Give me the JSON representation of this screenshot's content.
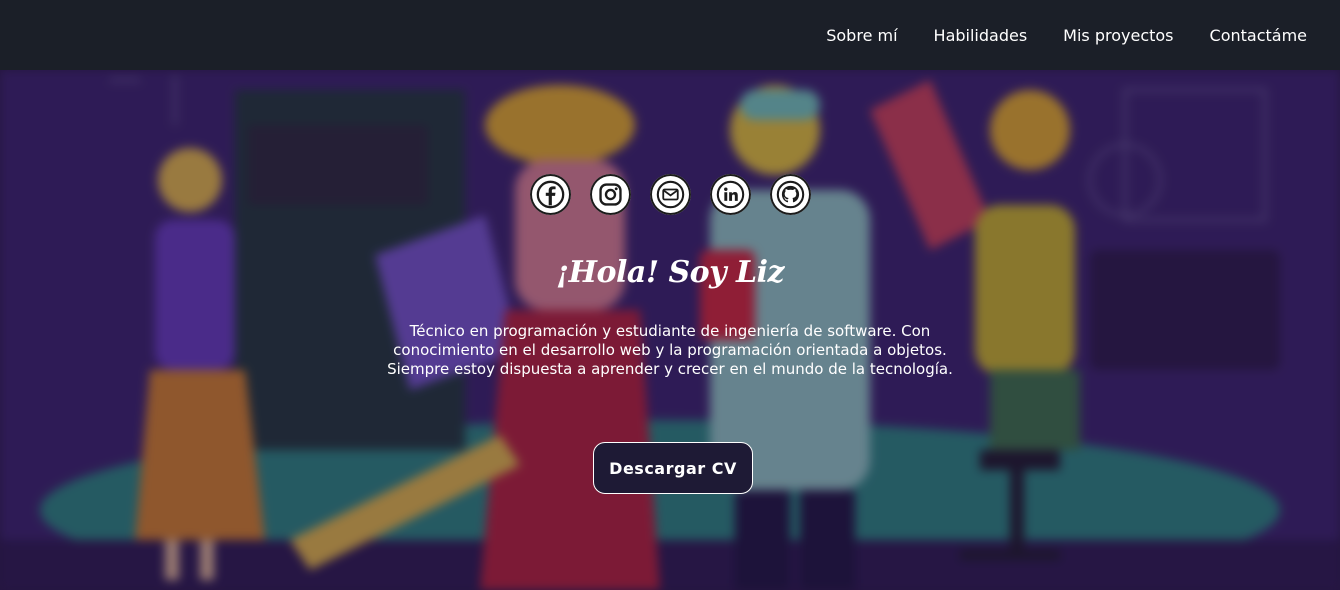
{
  "nav": {
    "items": [
      "Sobre mí",
      "Habilidades",
      "Mis proyectos",
      "Contactáme"
    ]
  },
  "social": [
    {
      "name": "facebook-icon"
    },
    {
      "name": "instagram-icon"
    },
    {
      "name": "email-icon"
    },
    {
      "name": "linkedin-icon"
    },
    {
      "name": "github-icon"
    }
  ],
  "hero": {
    "greeting": "¡Hola! Soy Liz",
    "bio_lines": [
      "Técnico en programación y estudiante de ingeniería de software. Con",
      "conocimiento en el desarrollo web y la programación orientada a objetos.",
      "Siempre estoy dispuesta a aprender y crecer en el mundo de la tecnología."
    ],
    "cv_button": "Descargar CV"
  },
  "colors": {
    "navbar_bg": "#1b1f28",
    "hero_bg": "#2d1b56",
    "button_bg": "#1e1a35",
    "text": "#ffffff"
  }
}
